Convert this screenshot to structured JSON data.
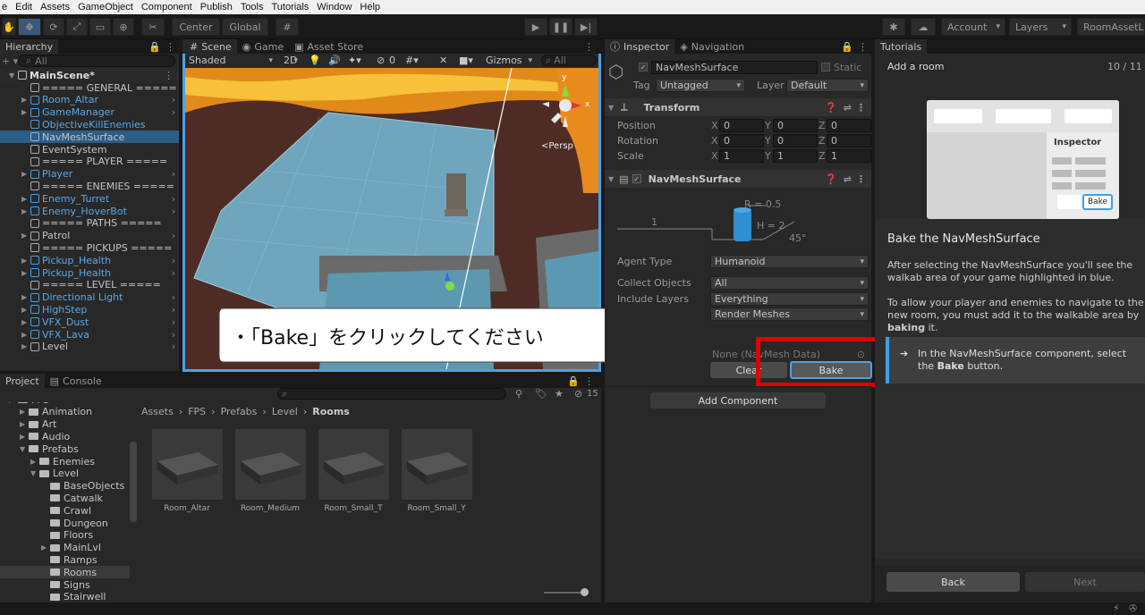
{
  "menu": [
    "e",
    "Edit",
    "Assets",
    "GameObject",
    "Component",
    "Publish",
    "Tools",
    "Tutorials",
    "Window",
    "Help"
  ],
  "toolbar": {
    "center": "Center",
    "global": "Global",
    "account": "Account",
    "layers": "Layers",
    "layout": "RoomAssetLa"
  },
  "hierarchy": {
    "tab": "Hierarchy",
    "search_placeholder": "All",
    "scene": "MainScene*",
    "items": [
      {
        "label": "===== GENERAL =====",
        "blue": false,
        "arrow": false
      },
      {
        "label": "Room_Altar",
        "blue": true,
        "arrow": true
      },
      {
        "label": "GameManager",
        "blue": true,
        "arrow": true
      },
      {
        "label": "ObjectiveKillEnemies",
        "blue": true,
        "arrow": false
      },
      {
        "label": "NavMeshSurface",
        "blue": false,
        "arrow": false
      },
      {
        "label": "EventSystem",
        "blue": false,
        "arrow": false
      },
      {
        "label": "===== PLAYER =====",
        "blue": false,
        "arrow": false
      },
      {
        "label": "Player",
        "blue": true,
        "arrow": true
      },
      {
        "label": "===== ENEMIES =====",
        "blue": false,
        "arrow": false
      },
      {
        "label": "Enemy_Turret",
        "blue": true,
        "arrow": true
      },
      {
        "label": "Enemy_HoverBot",
        "blue": true,
        "arrow": true
      },
      {
        "label": "===== PATHS =====",
        "blue": false,
        "arrow": false
      },
      {
        "label": "Patrol",
        "blue": false,
        "arrow": true
      },
      {
        "label": "===== PICKUPS =====",
        "blue": false,
        "arrow": false
      },
      {
        "label": "Pickup_Health",
        "blue": true,
        "arrow": true
      },
      {
        "label": "Pickup_Health",
        "blue": true,
        "arrow": true
      },
      {
        "label": "===== LEVEL =====",
        "blue": false,
        "arrow": false
      },
      {
        "label": "Directional Light",
        "blue": true,
        "arrow": true
      },
      {
        "label": "HighStep",
        "blue": true,
        "arrow": true
      },
      {
        "label": "VFX_Dust",
        "blue": true,
        "arrow": true
      },
      {
        "label": "VFX_Lava",
        "blue": true,
        "arrow": true
      },
      {
        "label": "Level",
        "blue": false,
        "arrow": true
      }
    ]
  },
  "scene": {
    "tabs": [
      "Scene",
      "Game",
      "Asset Store"
    ],
    "shading": "Shaded",
    "mode2d": "2D",
    "fx_count": "0",
    "gizmos": "Gizmos",
    "search_placeholder": "All",
    "persp": "<Persp",
    "axis_y": "y",
    "axis_x": "x",
    "callout": "・「Bake」をクリックしてください"
  },
  "project": {
    "tabs": [
      "Project",
      "Console"
    ],
    "hidden_count": "15",
    "breadcrumb": [
      "Assets",
      "FPS",
      "Prefabs",
      "Level",
      "Rooms"
    ],
    "tree": [
      {
        "label": "FPS",
        "indent": 0
      },
      {
        "label": "Animation",
        "indent": 1
      },
      {
        "label": "Art",
        "indent": 1
      },
      {
        "label": "Audio",
        "indent": 1
      },
      {
        "label": "Prefabs",
        "indent": 1
      },
      {
        "label": "Enemies",
        "indent": 2
      },
      {
        "label": "Level",
        "indent": 2
      },
      {
        "label": "BaseObjects",
        "indent": 3
      },
      {
        "label": "Catwalk",
        "indent": 3
      },
      {
        "label": "Crawl",
        "indent": 3
      },
      {
        "label": "Dungeon",
        "indent": 3
      },
      {
        "label": "Floors",
        "indent": 3
      },
      {
        "label": "MainLvl",
        "indent": 3
      },
      {
        "label": "Ramps",
        "indent": 3
      },
      {
        "label": "Rooms",
        "indent": 3
      },
      {
        "label": "Signs",
        "indent": 3
      },
      {
        "label": "Stairwell",
        "indent": 3
      }
    ],
    "assets": [
      "Room_Altar",
      "Room_Medium",
      "Room_Small_T",
      "Room_Small_Y"
    ]
  },
  "inspector": {
    "tabs": [
      "Inspector",
      "Navigation"
    ],
    "object_name": "NavMeshSurface",
    "static": "Static",
    "tag_label": "Tag",
    "tag": "Untagged",
    "layer_label": "Layer",
    "layer": "Default",
    "transform": "Transform",
    "position": "Position",
    "rotation": "Rotation",
    "scale": "Scale",
    "pos": [
      "0",
      "0",
      "0"
    ],
    "rot": [
      "0",
      "0",
      "0"
    ],
    "scl": [
      "1",
      "1",
      "1"
    ],
    "axes": [
      "X",
      "Y",
      "Z"
    ],
    "navmesh": "NavMeshSurface",
    "diagram": {
      "r": "R = 0.5",
      "h": "H = 2",
      "one": "1",
      "angle": "45°"
    },
    "agent_type_label": "Agent Type",
    "agent_type": "Humanoid",
    "collect_label": "Collect Objects",
    "collect": "All",
    "include_label": "Include Layers",
    "include": "Everything",
    "geometry": "Render Meshes",
    "navdata": "None (NavMesh Data)",
    "clear": "Clear",
    "bake": "Bake",
    "add_component": "Add Component"
  },
  "tutorials": {
    "tab": "Tutorials",
    "title": "Add a room",
    "progress": "10 / 11",
    "illus_inspector": "Inspector",
    "illus_bake": "Bake",
    "heading": "Bake the NavMeshSurface",
    "p1": "After selecting the NavMeshSurface you'll see the walkab area of your game highlighted in blue.",
    "p2a": "To allow your player and enemies to navigate to the new room, you must add it to the walkable area by ",
    "p2b": "baking",
    "p2c": " it.",
    "task_a": "In the NavMeshSurface component, select the ",
    "task_b": "Bake",
    "task_c": " button.",
    "back": "Back",
    "next": "Next"
  }
}
